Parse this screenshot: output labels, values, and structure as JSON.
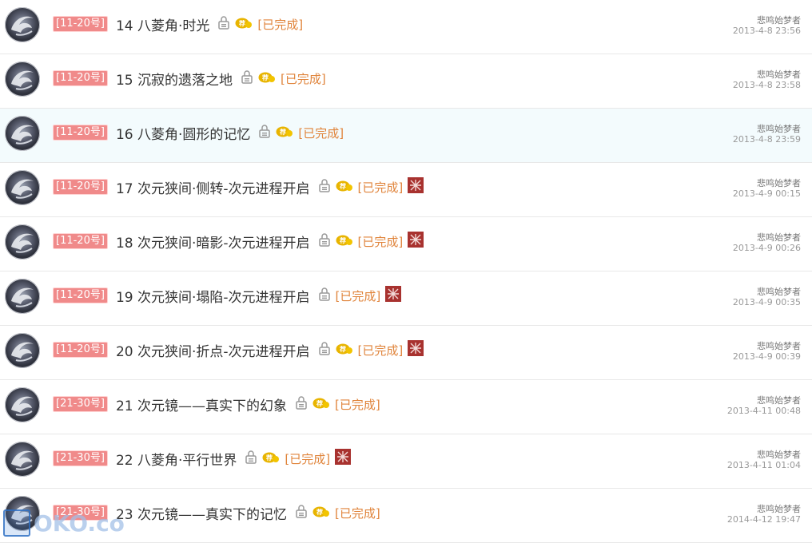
{
  "rows": [
    {
      "tag": "11-20号",
      "title": "14 八菱角·时光",
      "has_rec": true,
      "status": "[已完成]",
      "has_x": false,
      "author": "悲鸣始梦者",
      "time": "2013-4-8 23:56",
      "highlight": false
    },
    {
      "tag": "11-20号",
      "title": "15 沉寂的遗落之地",
      "has_rec": true,
      "status": "[已完成]",
      "has_x": false,
      "author": "悲鸣始梦者",
      "time": "2013-4-8 23:58",
      "highlight": false
    },
    {
      "tag": "11-20号",
      "title": "16 八菱角·圆形的记忆",
      "has_rec": true,
      "status": "[已完成]",
      "has_x": false,
      "author": "悲鸣始梦者",
      "time": "2013-4-8 23:59",
      "highlight": true
    },
    {
      "tag": "11-20号",
      "title": "17 次元狭间·侧转-次元进程开启",
      "has_rec": true,
      "status": "[已完成]",
      "has_x": true,
      "author": "悲鸣始梦者",
      "time": "2013-4-9 00:15",
      "highlight": false
    },
    {
      "tag": "11-20号",
      "title": "18 次元狭间·暗影-次元进程开启",
      "has_rec": true,
      "status": "[已完成]",
      "has_x": true,
      "author": "悲鸣始梦者",
      "time": "2013-4-9 00:26",
      "highlight": false
    },
    {
      "tag": "11-20号",
      "title": "19 次元狭间·塌陷-次元进程开启",
      "has_rec": false,
      "status": "[已完成]",
      "has_x": true,
      "author": "悲鸣始梦者",
      "time": "2013-4-9 00:35",
      "highlight": false
    },
    {
      "tag": "11-20号",
      "title": "20 次元狭间·折点-次元进程开启",
      "has_rec": true,
      "status": "[已完成]",
      "has_x": true,
      "author": "悲鸣始梦者",
      "time": "2013-4-9 00:39",
      "highlight": false
    },
    {
      "tag": "21-30号",
      "title": "21 次元镜——真实下的幻象",
      "has_rec": true,
      "status": "[已完成]",
      "has_x": false,
      "author": "悲鸣始梦者",
      "time": "2013-4-11 00:48",
      "highlight": false
    },
    {
      "tag": "21-30号",
      "title": "22 八菱角·平行世界",
      "has_rec": true,
      "status": "[已完成]",
      "has_x": true,
      "author": "悲鸣始梦者",
      "time": "2013-4-11 01:04",
      "highlight": false
    },
    {
      "tag": "21-30号",
      "title": "23 次元镜——真实下的记忆",
      "has_rec": true,
      "status": "[已完成]",
      "has_x": false,
      "author": "悲鸣始梦者",
      "time": "2014-4-12 19:47",
      "highlight": false
    }
  ],
  "watermark": "OKO.co",
  "colors": {
    "tag_bg": "#f08a8a",
    "status": "#e0843b",
    "x_badge": "#a8322f",
    "highlight": "#f3fbfd"
  }
}
